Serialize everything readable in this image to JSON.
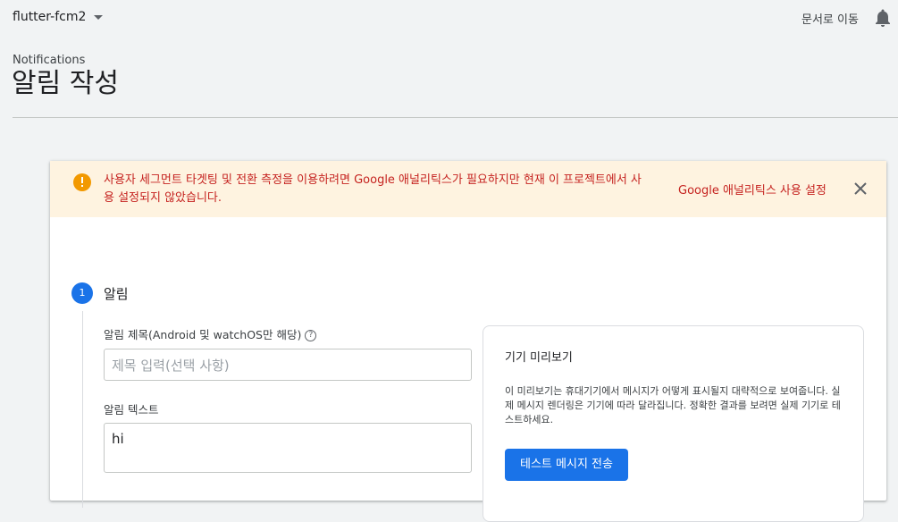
{
  "header": {
    "project_name": "flutter-fcm2",
    "docs_link": "문서로 이동",
    "icons": {
      "project_dropdown": "caret-down-icon",
      "notifications": "bell-icon"
    }
  },
  "breadcrumb": "Notifications",
  "page_title": "알림 작성",
  "banner": {
    "message": "사용자 세그먼트 타겟팅 및 전환 측정을 이용하려면 Google 애널리틱스가 필요하지만 현재 이 프로젝트에서 사용 설정되지 않았습니다.",
    "action_label": "Google 애널리틱스 사용 설정",
    "icons": {
      "status": "warning-icon",
      "dismiss": "close-icon"
    },
    "colors": {
      "background": "#fef3e0",
      "text": "#c5221f",
      "icon": "#f29900"
    }
  },
  "step": {
    "number": "1",
    "title": "알림",
    "title_field": {
      "label": "알림 제목(Android 및 watchOS만 해당)",
      "help_glyph": "?",
      "placeholder": "제목 입력(선택 사항)",
      "value": ""
    },
    "text_field": {
      "label": "알림 텍스트",
      "value": "hi"
    }
  },
  "preview": {
    "title": "기기 미리보기",
    "description": "이 미리보기는 휴대기기에서 메시지가 어떻게 표시될지 대략적으로 보여줍니다. 실제 메시지 렌더링은 기기에 따라 달라집니다. 정확한 결과를 보려면 실제 기기로 테스트하세요.",
    "test_button": "테스트 메시지 전송"
  },
  "colors": {
    "accent": "#1a73e8"
  }
}
